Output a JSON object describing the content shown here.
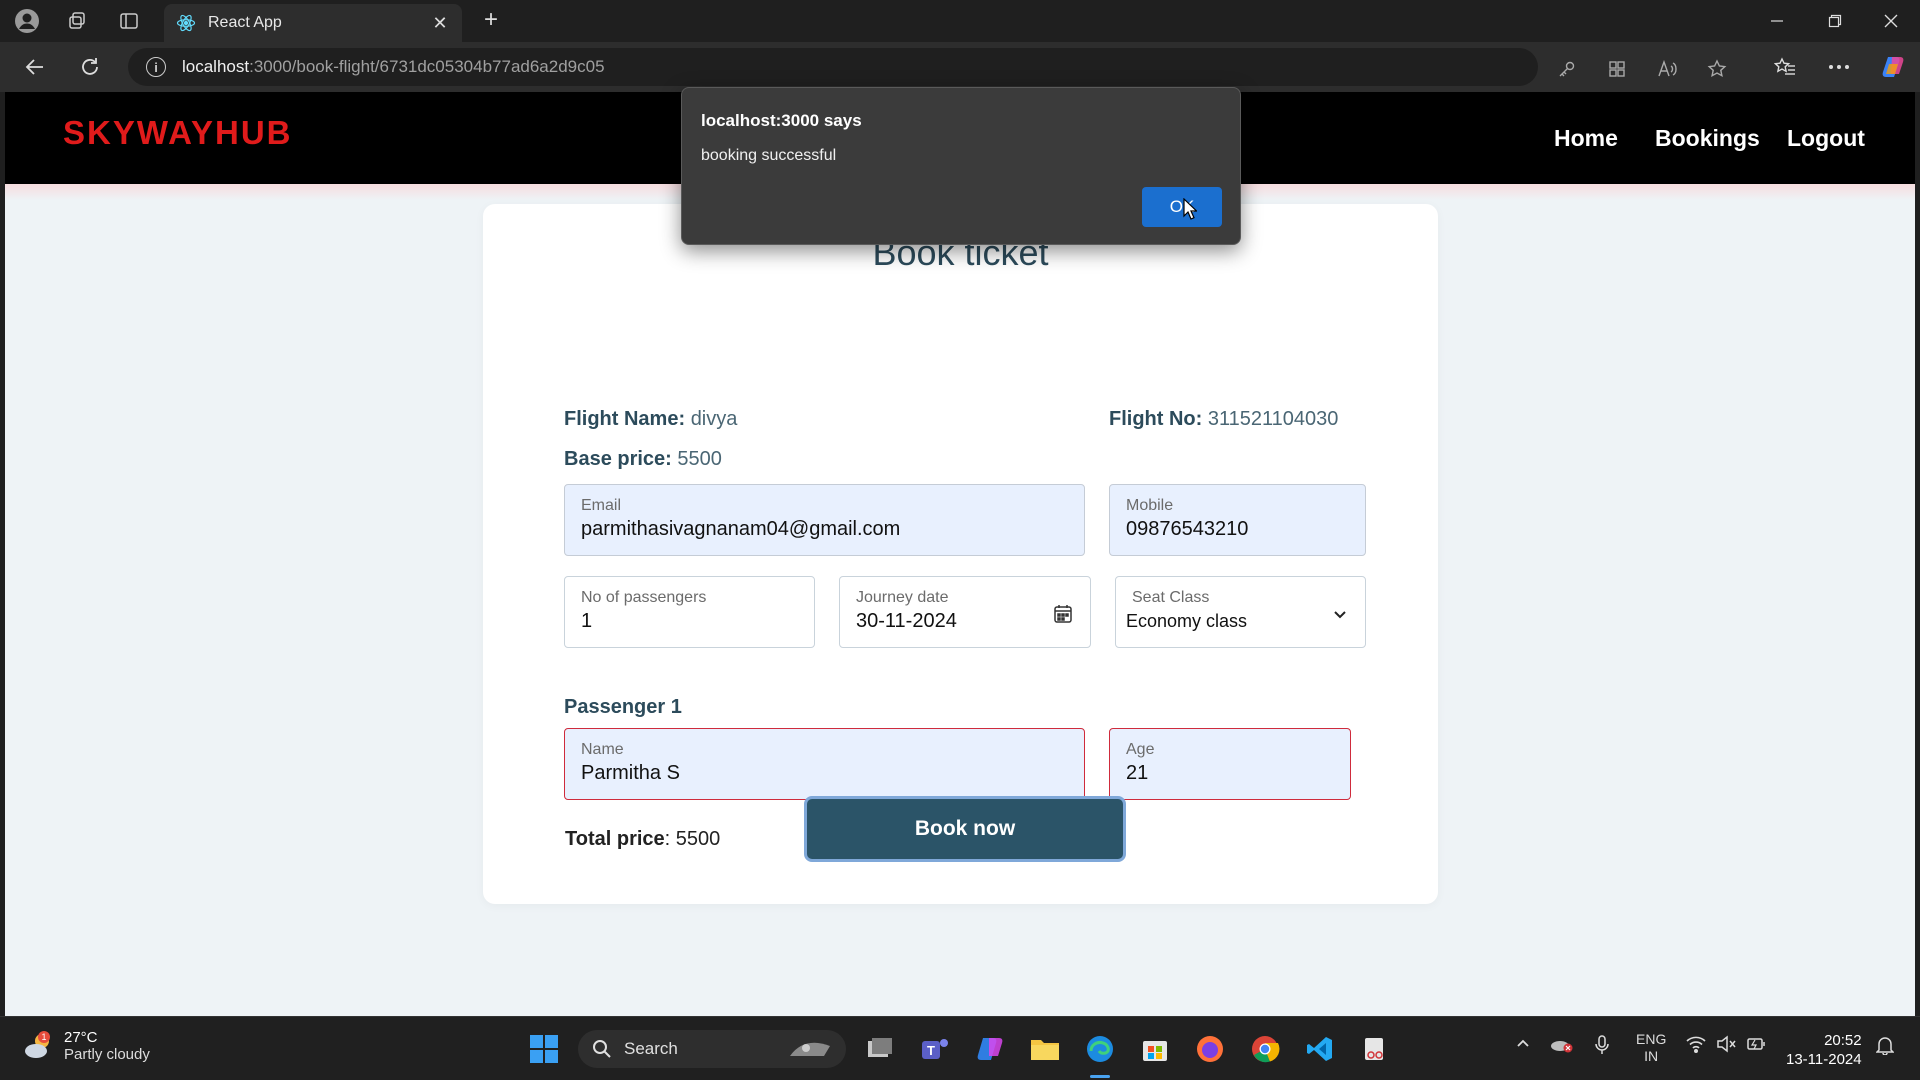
{
  "browser": {
    "tab_title": "React App",
    "url_host": "localhost",
    "url_path": ":3000/book-flight/6731dc05304b77ad6a2d9c05"
  },
  "app": {
    "logo": "SKYWAYHUB",
    "nav": [
      "Home",
      "Bookings",
      "Logout"
    ]
  },
  "form": {
    "title": "Book ticket",
    "flight_name_label": "Flight Name:",
    "flight_name": "divya",
    "flight_no_label": "Flight No:",
    "flight_no": "311521104030",
    "base_price_label": "Base price:",
    "base_price": "5500",
    "email_label": "Email",
    "email_value": "parmithasivagnanam04@gmail.com",
    "mobile_label": "Mobile",
    "mobile_value": "09876543210",
    "passengers_label": "No of passengers",
    "passengers_value": "1",
    "journey_label": "Journey date",
    "journey_value": "30-11-2024",
    "seat_label": "Seat Class",
    "seat_value": "Economy class",
    "passenger_heading": "Passenger 1",
    "name_label": "Name",
    "name_value": "Parmitha S",
    "age_label": "Age",
    "age_value": "21",
    "total_label": "Total price",
    "total_value": ": 5500",
    "book_button": "Book now"
  },
  "dialog": {
    "title": "localhost:3000 says",
    "message": "booking successful",
    "ok_label": "OK"
  },
  "taskbar": {
    "temperature": "27°C",
    "weather": "Partly cloudy",
    "search_placeholder": "Search",
    "lang_top": "ENG",
    "lang_bottom": "IN",
    "time": "20:52",
    "date": "13-11-2024",
    "weather_badge": "1"
  }
}
